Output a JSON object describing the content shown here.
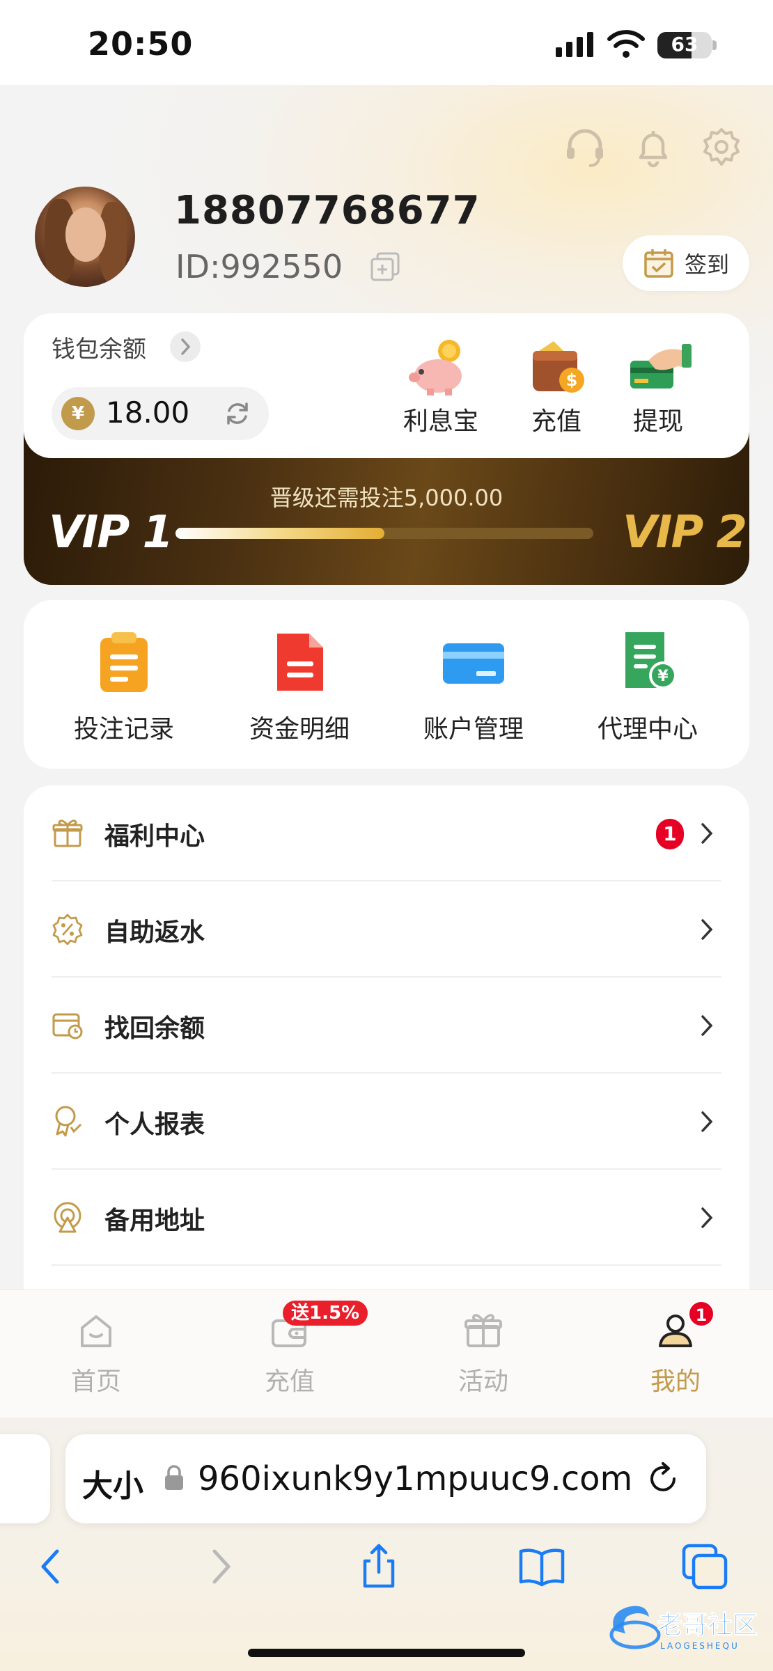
{
  "status_bar": {
    "time": "20:50",
    "battery": "63",
    "battery_level": 0.63
  },
  "header": {
    "phone": "18807768677",
    "user_id": "ID:992550",
    "checkin_label": "签到",
    "icons": [
      "headset-icon",
      "bell-icon",
      "gear-icon"
    ]
  },
  "wallet": {
    "label": "钱包余额",
    "currency_symbol": "¥",
    "balance": "18.00",
    "actions": [
      {
        "label": "利息宝",
        "icon": "piggy-bank-icon"
      },
      {
        "label": "充值",
        "icon": "wallet-deposit-icon"
      },
      {
        "label": "提现",
        "icon": "withdraw-card-icon"
      }
    ]
  },
  "vip": {
    "requirement": "晋级还需投注5,000.00",
    "current": "VIP 1",
    "next": "VIP 2",
    "progress": 0.5
  },
  "quick_links": [
    {
      "label": "投注记录",
      "icon": "bet-record-icon"
    },
    {
      "label": "资金明细",
      "icon": "fund-detail-icon"
    },
    {
      "label": "账户管理",
      "icon": "card-account-icon"
    },
    {
      "label": "代理中心",
      "icon": "agent-center-icon"
    }
  ],
  "menu": [
    {
      "label": "福利中心",
      "icon": "gift-icon",
      "badge": "1"
    },
    {
      "label": "自助返水",
      "icon": "rebate-icon",
      "badge": ""
    },
    {
      "label": "找回余额",
      "icon": "recover-balance-icon",
      "badge": ""
    },
    {
      "label": "个人报表",
      "icon": "report-medal-icon",
      "badge": ""
    },
    {
      "label": "备用地址",
      "icon": "backup-address-icon",
      "badge": ""
    }
  ],
  "tabs": [
    {
      "label": "首页",
      "icon": "home-icon",
      "active": false
    },
    {
      "label": "充值",
      "icon": "wallet-icon",
      "active": false
    },
    {
      "label": "活动",
      "icon": "gift-box-icon",
      "active": false
    },
    {
      "label": "我的",
      "icon": "user-icon",
      "active": true
    }
  ],
  "tab_promo": "送1.5%",
  "tab_badge": "1",
  "browser": {
    "text_size_label": "大小",
    "url": "960ixunk9y1mpuuc9.com"
  },
  "colors": {
    "gold": "#c39a4a",
    "badge_red": "#e60023",
    "vip_gold": "#e8b84a"
  }
}
